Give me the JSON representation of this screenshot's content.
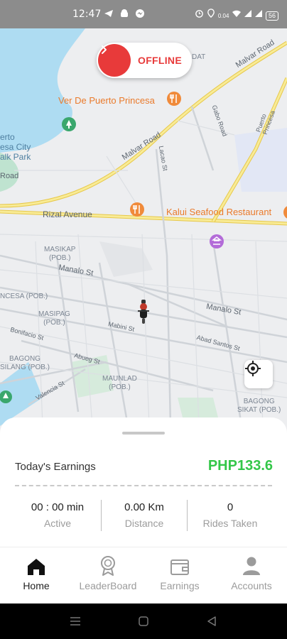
{
  "status_bar": {
    "time": "12:47",
    "left_icons": [
      "telegram-icon",
      "android-icon",
      "messenger-icon"
    ],
    "right_icons": [
      "alarm-icon",
      "location-icon",
      "data-speed-icon",
      "wifi-icon",
      "signal-icon",
      "signal-icon",
      "battery-icon"
    ],
    "data_speed": "0.04",
    "battery": "56"
  },
  "map": {
    "road_labels": [
      "Malvar Road",
      "Malvar Road",
      "Rizal Avenue",
      "Manalo St",
      "Manalo St",
      "Mabini St",
      "Abad Santos St",
      "Bonifacio St",
      "Abueg St",
      "Valencia St",
      "Lacao St",
      "Gabo Road",
      "Puerto Princesa",
      "Road"
    ],
    "area_labels": [
      "MASIKAP\n(POB.)",
      "MASIPAG\n(POB.)",
      "MAUNLAD\n(POB.)",
      "BAGONG\nSILANG (POB.)",
      "BAGONG\nSIKAT (POB.)",
      "NCESA (POB.)",
      "erto\nesa City\nalk Park",
      "DAT"
    ],
    "poi_labels": [
      "Ver De Puerto Princesa",
      "Kalui Seafood Restaurant"
    ]
  },
  "toggle": {
    "label": "OFFLINE"
  },
  "earnings": {
    "label": "Today's Earnings",
    "value": "PHP133.6",
    "stats": [
      {
        "value": "00 : 00 min",
        "label": "Active"
      },
      {
        "value": "0.00 Km",
        "label": "Distance"
      },
      {
        "value": "0",
        "label": "Rides Taken"
      }
    ]
  },
  "nav": {
    "items": [
      {
        "label": "Home",
        "icon": "home-icon",
        "active": true
      },
      {
        "label": "LeaderBoard",
        "icon": "medal-icon",
        "active": false
      },
      {
        "label": "Earnings",
        "icon": "wallet-icon",
        "active": false
      },
      {
        "label": "Accounts",
        "icon": "person-icon",
        "active": false
      }
    ]
  },
  "colors": {
    "accent_red": "#e83a3a",
    "earn_green": "#34c749",
    "poi_orange": "#ea7a2b",
    "road_yellow": "#f5e27c"
  }
}
